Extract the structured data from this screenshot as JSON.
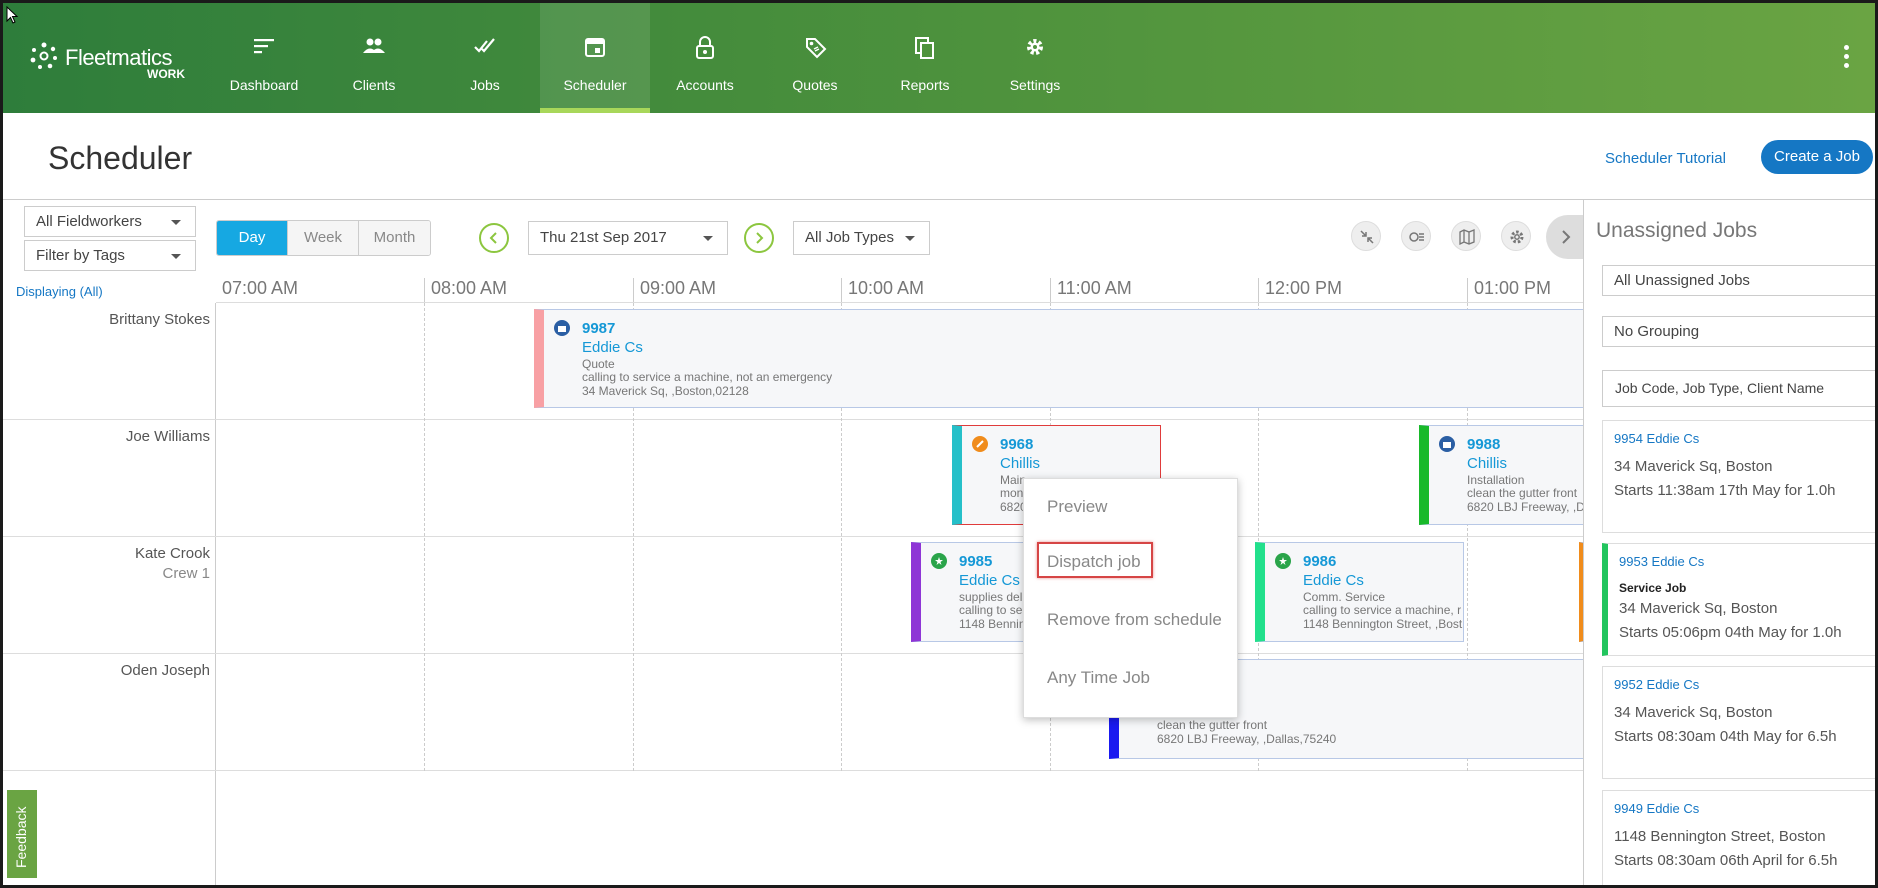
{
  "nav": {
    "logo_word": "Fleetmatics",
    "logo_sub": "WORK",
    "items": [
      {
        "label": "Dashboard",
        "icon": "dashboard-icon"
      },
      {
        "label": "Clients",
        "icon": "clients-icon"
      },
      {
        "label": "Jobs",
        "icon": "jobs-icon"
      },
      {
        "label": "Scheduler",
        "icon": "calendar-icon"
      },
      {
        "label": "Accounts",
        "icon": "lock-icon"
      },
      {
        "label": "Quotes",
        "icon": "tag-icon"
      },
      {
        "label": "Reports",
        "icon": "reports-icon"
      },
      {
        "label": "Settings",
        "icon": "gear-icon"
      }
    ],
    "active": "Scheduler"
  },
  "header": {
    "title": "Scheduler",
    "tutorial_link": "Scheduler Tutorial",
    "create_button": "Create a Job"
  },
  "filters": {
    "fieldworkers": "All Fieldworkers",
    "tags": "Filter by Tags",
    "views": [
      "Day",
      "Week",
      "Month"
    ],
    "active_view": "Day",
    "date": "Thu 21st Sep 2017",
    "job_types": "All Job Types",
    "displaying": "Displaying (All)"
  },
  "timeline": {
    "ticks": [
      "07:00 AM",
      "08:00 AM",
      "09:00 AM",
      "10:00 AM",
      "11:00 AM",
      "12:00 PM",
      "01:00 PM"
    ]
  },
  "workers": [
    {
      "name": "Brittany Stokes",
      "crew": ""
    },
    {
      "name": "Joe Williams",
      "crew": ""
    },
    {
      "name": "Kate Crook",
      "crew": "Crew 1"
    },
    {
      "name": "Oden Joseph",
      "crew": ""
    }
  ],
  "jobs": [
    {
      "code": "9987",
      "client": "Eddie Cs",
      "type": "Quote",
      "desc": "calling to service a machine, not an emergency",
      "address": "34 Maverick Sq, ,Boston,02128"
    },
    {
      "code": "9968",
      "client": "Chillis",
      "type": "Main",
      "desc": "mon",
      "address": "6820"
    },
    {
      "code": "9988",
      "client": "Chillis",
      "type": "Installation",
      "desc": "clean the gutter front",
      "address": "6820 LBJ Freeway, ,Da"
    },
    {
      "code": "9985",
      "client": "Eddie Cs",
      "type": "supplies deli",
      "desc": "calling to ser",
      "address": "1148 Bennin"
    },
    {
      "code": "9986",
      "client": "Eddie Cs",
      "type": "Comm. Service",
      "desc": "calling to service a machine, r",
      "address": "1148 Bennington Street, ,Bost"
    },
    {
      "code": "",
      "client": "",
      "type": "",
      "desc": "clean the gutter front",
      "address": "6820 LBJ Freeway, ,Dallas,75240"
    }
  ],
  "context_menu": {
    "items": [
      "Preview",
      "Dispatch job",
      "Remove from schedule",
      "Any Time Job"
    ],
    "highlighted": "Dispatch job"
  },
  "feedback": "Feedback",
  "unassigned": {
    "title": "Unassigned Jobs",
    "filter": "All Unassigned Jobs",
    "grouping": "No Grouping",
    "search_placeholder": "Job Code, Job Type, Client Name",
    "cards": [
      {
        "header": "9954 Eddie Cs",
        "type": "",
        "address": "34 Maverick Sq, Boston",
        "starts": "Starts 11:38am 17th May for 1.0h"
      },
      {
        "header": "9953 Eddie Cs",
        "type": "Service Job",
        "address": "34 Maverick Sq, Boston",
        "starts": "Starts 05:06pm 04th May for 1.0h"
      },
      {
        "header": "9952 Eddie Cs",
        "type": "",
        "address": "34 Maverick Sq, Boston",
        "starts": "Starts 08:30am 04th May for 6.5h"
      },
      {
        "header": "9949 Eddie Cs",
        "type": "",
        "address": "1148 Bennington Street, Boston",
        "starts": "Starts 08:30am 06th April for 6.5h"
      }
    ]
  },
  "colors": {
    "nav_green": "#4f933d",
    "accent_blue": "#1577c4",
    "view_active": "#16a8e2",
    "highlight_red": "#d64545"
  }
}
